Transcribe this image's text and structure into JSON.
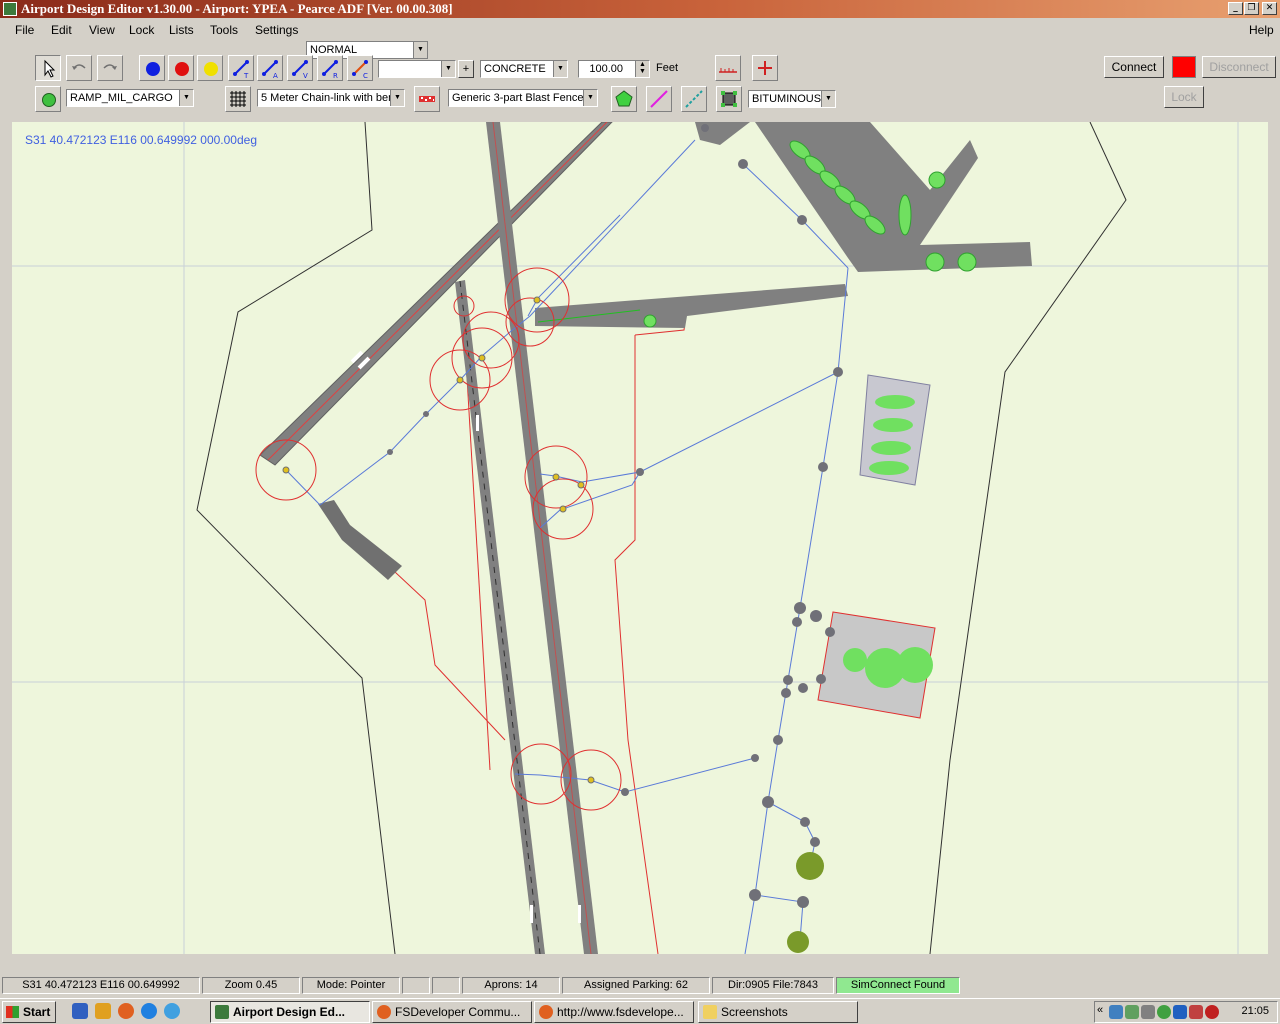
{
  "window": {
    "title": "Airport Design Editor  v1.30.00  -  Airport: YPEA - Pearce ADF [Ver. 00.00.308]"
  },
  "menu": {
    "items": [
      "File",
      "Edit",
      "View",
      "Lock",
      "Lists",
      "Tools",
      "Settings",
      "Help"
    ],
    "mode": "NORMAL"
  },
  "toolbar": {
    "surface": "CONCRETE",
    "length_value": "100.00",
    "length_unit": "Feet",
    "parking_type": "RAMP_MIL_CARGO",
    "fence_type": "5 Meter Chain-link with bent",
    "blast_fence": "Generic 3-part Blast Fence",
    "apron_surface": "BITUMINOUS",
    "connect_label": "Connect",
    "disconnect_label": "Disconnect",
    "lock_label": "Lock",
    "tool_colors": {
      "blue": "#1020e0",
      "red": "#e01010",
      "yellow": "#f0e000",
      "status_red": "#ff0000"
    }
  },
  "map": {
    "coords": "S31 40.472123   E116 00.649992 000.00deg"
  },
  "status": {
    "position": "S31 40.472123   E116 00.649992",
    "zoom": "Zoom 0.45",
    "mode": "Mode: Pointer",
    "aprons": "Aprons: 14",
    "parking": "Assigned Parking: 62",
    "dir": "Dir:0905  File:7843",
    "simconnect": "SimConnect Found"
  },
  "taskbar": {
    "start": "Start",
    "tasks": [
      "Airport Design Ed...",
      "FSDeveloper Commu...",
      "http://www.fsdevelope...",
      "Screenshots"
    ],
    "clock": "21:05"
  }
}
